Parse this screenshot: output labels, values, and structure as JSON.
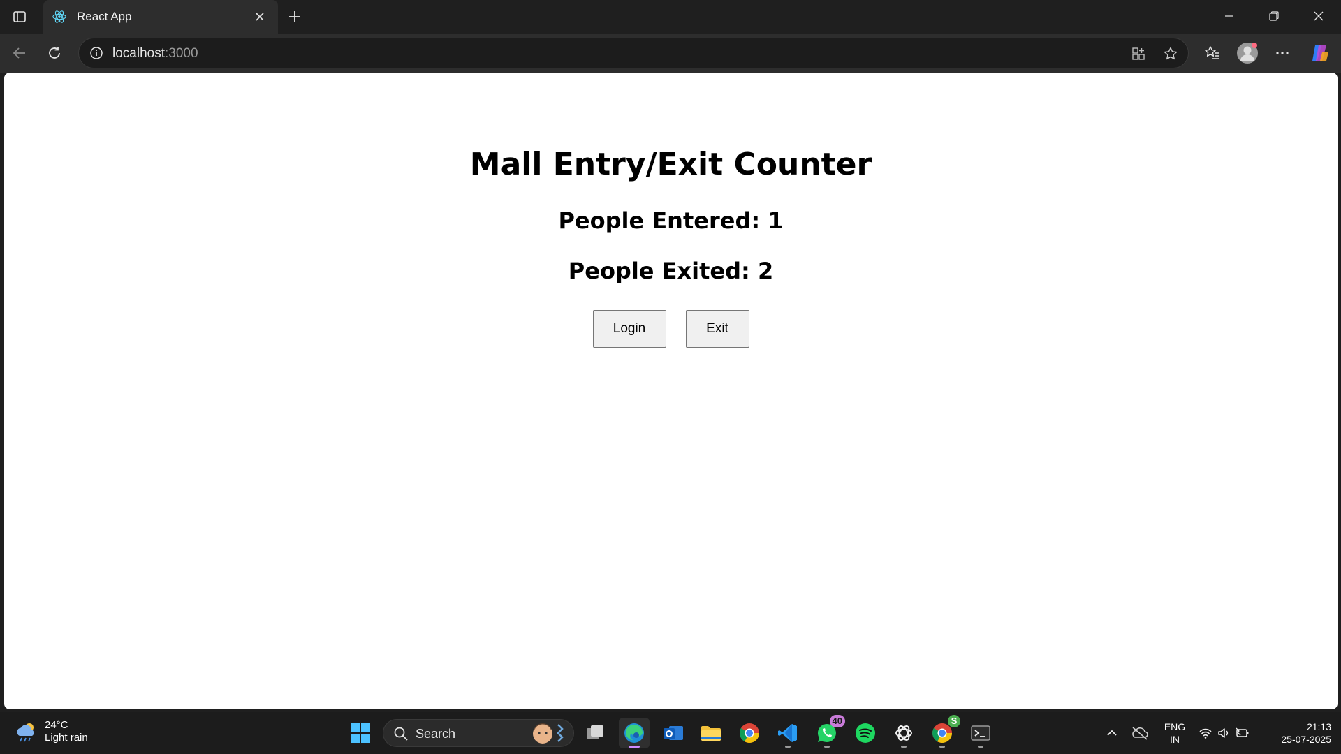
{
  "browser": {
    "tab_title": "React App",
    "address_host": "localhost",
    "address_port": ":3000"
  },
  "page": {
    "title": "Mall Entry/Exit Counter",
    "entered_label": "People Entered: 1",
    "exited_label": "People Exited: 2",
    "login_button": "Login",
    "exit_button": "Exit"
  },
  "taskbar": {
    "weather_temp": "24°C",
    "weather_desc": "Light rain",
    "search_label": "Search",
    "whatsapp_badge": "40",
    "chrome_badge": "S",
    "lang_top": "ENG",
    "lang_bottom": "IN",
    "time": "21:13",
    "date": "25-07-2025"
  },
  "colors": {
    "chrome_dark": "#1f1f1f",
    "toolbar": "#2d2d2d",
    "page_bg": "#ffffff",
    "active_indicator": "#d08aff"
  }
}
